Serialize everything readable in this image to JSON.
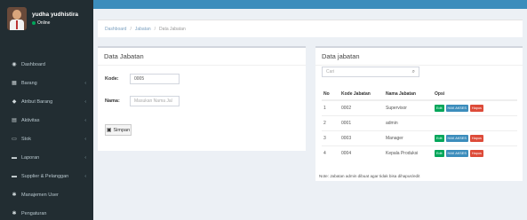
{
  "user": {
    "name": "yudha yudhistira",
    "status": "Online"
  },
  "menu": [
    {
      "icon": "dashboard-icon",
      "glyph": "◉",
      "label": "Dashboard",
      "chevron": false
    },
    {
      "icon": "table-icon",
      "glyph": "▦",
      "label": "Barang",
      "chevron": true
    },
    {
      "icon": "tag-icon",
      "glyph": "◆",
      "label": "Atribut Barang",
      "chevron": true
    },
    {
      "icon": "list-icon",
      "glyph": "▤",
      "label": "Aktivitas",
      "chevron": true
    },
    {
      "icon": "monitor-icon",
      "glyph": "▭",
      "label": "Stok",
      "chevron": true
    },
    {
      "icon": "book-icon",
      "glyph": "▬",
      "label": "Laporan",
      "chevron": true
    },
    {
      "icon": "book-icon",
      "glyph": "▬",
      "label": "Supplier & Pelanggan",
      "chevron": true
    },
    {
      "icon": "gear-icon",
      "glyph": "✱",
      "label": "Manajemen User",
      "chevron": false
    },
    {
      "icon": "gear-icon",
      "glyph": "✱",
      "label": "Pengaturan",
      "chevron": false
    }
  ],
  "breadcrumb": {
    "home": "Dashboard",
    "section": "Jabatan",
    "current": "Data Jabatan",
    "separator": "/"
  },
  "form": {
    "title": "Data Jabatan",
    "kode_label": "Kode:",
    "kode_value": "0005",
    "nama_label": "Nama:",
    "nama_placeholder": "Masukan Nama Jal",
    "save_label": "Simpan"
  },
  "list": {
    "title": "Data jabatan",
    "search_placeholder": "Cari",
    "headers": [
      "No",
      "Kode Jabatan",
      "Nama Jabatan",
      "Opsi"
    ],
    "rows": [
      {
        "no": "1",
        "kode": "0002",
        "nama": "Supervisor",
        "ops": true
      },
      {
        "no": "2",
        "kode": "0001",
        "nama": "admin",
        "ops": false
      },
      {
        "no": "3",
        "kode": "0003",
        "nama": "Manager",
        "ops": true
      },
      {
        "no": "4",
        "kode": "0004",
        "nama": "Kepala Produksi",
        "ops": true
      }
    ],
    "btn_edit": "Edit",
    "btn_hak": "HAK AKSES",
    "btn_hapus": "Hapus",
    "note": "Note: Jabatan admin dibuat agar tidak bisa dihapus/edit"
  },
  "colors": {
    "sidebar": "#222d32",
    "topbar": "#3c8dbc",
    "edit": "#00a65a",
    "hak": "#3c8dbc",
    "hapus": "#dd4b39"
  }
}
